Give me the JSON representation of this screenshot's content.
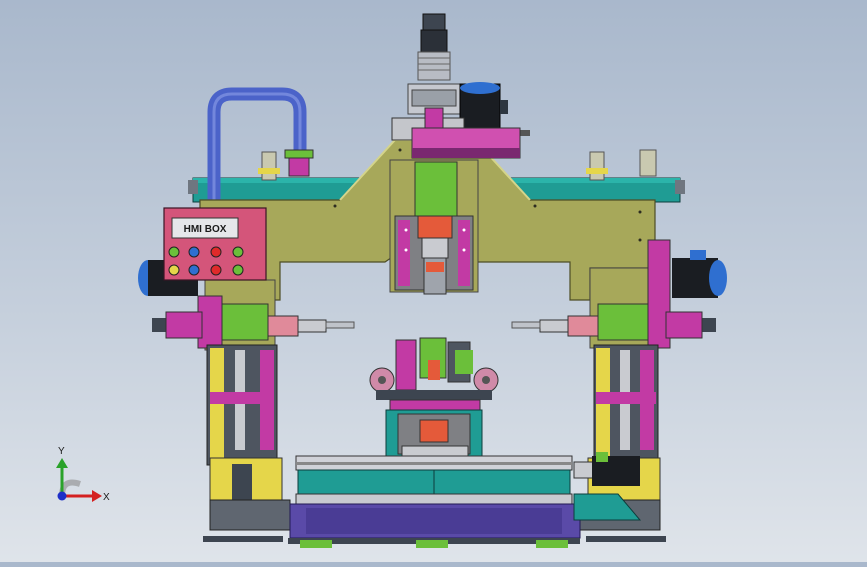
{
  "hmi_box": {
    "label": "HMI BOX"
  },
  "triad": {
    "x_label": "X",
    "y_label": "Y"
  },
  "colors": {
    "frame": "#a7a85a",
    "teal_beam": "#1f9c94",
    "dark_teal": "#14615f",
    "magenta": "#c23aa4",
    "lime": "#6bbf3a",
    "steel": "#8a8f99",
    "navy": "#20306a",
    "orange": "#d08a2a",
    "purple_base": "#5a4aa8",
    "pipe_blue": "#4b63c9",
    "motor_blue": "#2f6fd0",
    "dark_slate": "#3d4550"
  }
}
